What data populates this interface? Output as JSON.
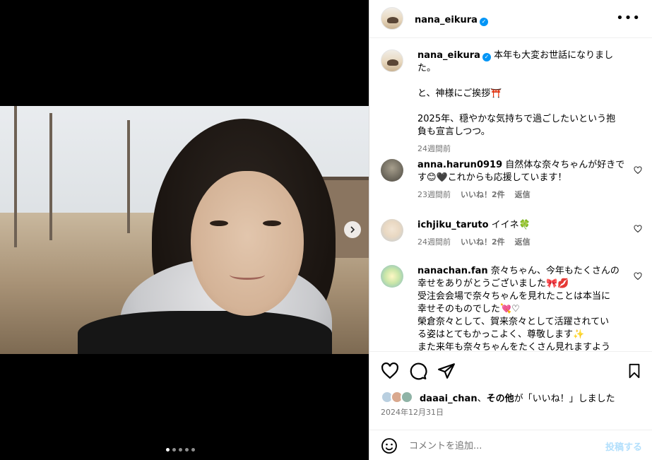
{
  "post": {
    "username": "nana_eikura",
    "caption_line1": "本年も大変お世話になりました。",
    "caption_line2": "と、神様にご挨拶⛩️",
    "caption_line3": "2025年、穏やかな気持ちで過ごしたいという抱",
    "caption_line4": "負も宣言しつつ。",
    "caption_time": "24週間前",
    "more_icon": "more-horizontal-icon"
  },
  "carousel": {
    "slide_count": 5,
    "active_slide": 1
  },
  "comments": [
    {
      "username": "anna.harun0919",
      "text_line1": "自然体な奈々ちゃんが好きで",
      "text_line2": "す😊🖤これからも応援しています！",
      "time": "23週間前",
      "likes": "いいね！2件",
      "reply": "返信"
    },
    {
      "username": "ichjiku_taruto",
      "text_line1": "イイネ🍀",
      "time": "24週間前",
      "likes": "いいね！2件",
      "reply": "返信"
    },
    {
      "username": "nanachan.fan",
      "text_line1": "奈々ちゃん、今年もたくさんの",
      "text_line2": "幸せをありがとうございました🎀💋",
      "text_line3": "受注会会場で奈々ちゃんを見れたことは本当に",
      "text_line4": "幸せそのものでした💘♡",
      "text_line5": "榮倉奈々として、賀来奈々として活躍されてい",
      "text_line6": "る姿はとてもかっこよく、尊敬します✨",
      "text_line7": "また来年も奈々ちゃんをたくさん見れますよう"
    }
  ],
  "liked_by": {
    "username": "daaai_chan",
    "text_mid": "、",
    "others": "その他",
    "text_end": "が「いいね！」しました"
  },
  "post_date": "2024年12月31日",
  "add_comment": {
    "placeholder": "コメントを追加...",
    "post_label": "投稿する"
  },
  "colors": {
    "verified": "#0095f6",
    "secondary_text": "#737373",
    "post_button_disabled": "#b2dffc"
  }
}
